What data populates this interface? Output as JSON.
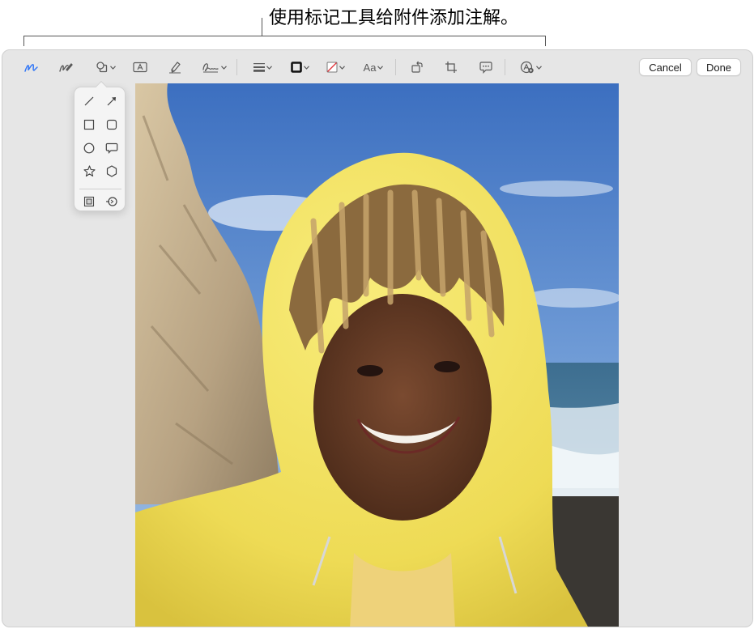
{
  "caption": {
    "text": "使用标记工具给附件添加注解。"
  },
  "toolbar": {
    "tools": [
      {
        "name": "sketch-tool",
        "icon": "sketch-pen-icon",
        "active": true
      },
      {
        "name": "draw-tool",
        "icon": "draw-pen-icon"
      },
      {
        "name": "shapes-tool",
        "icon": "shapes-icon",
        "has_menu": true
      },
      {
        "name": "text-tool",
        "icon": "text-box-icon"
      },
      {
        "name": "highlight-tool",
        "icon": "highlighter-icon"
      },
      {
        "name": "sign-tool",
        "icon": "signature-icon",
        "has_menu": true
      },
      {
        "name": "shape-style-tool",
        "icon": "line-weight-icon",
        "has_menu": true
      },
      {
        "name": "border-color-tool",
        "icon": "border-color-icon",
        "has_menu": true
      },
      {
        "name": "fill-color-tool",
        "icon": "fill-color-icon",
        "has_menu": true
      },
      {
        "name": "text-style-tool",
        "icon": "text-style-icon",
        "has_menu": true
      },
      {
        "name": "rotate-tool",
        "icon": "rotate-icon"
      },
      {
        "name": "crop-tool",
        "icon": "crop-icon"
      },
      {
        "name": "description-tool",
        "icon": "speech-bubble-icon"
      },
      {
        "name": "more-tools",
        "icon": "more-tools-icon",
        "has_menu": true
      }
    ],
    "text_style_label": "Aa",
    "cancel_label": "Cancel",
    "done_label": "Done",
    "accent_color": "#3478f6"
  },
  "shapes_popover": {
    "items": [
      "line-icon",
      "arrow-icon",
      "square-icon",
      "rounded-square-icon",
      "circle-icon",
      "speech-bubble-shape-icon",
      "star-icon",
      "hexagon-icon",
      "mask-icon",
      "loupe-icon"
    ]
  },
  "photo": {
    "subject": "smiling person in yellow hooded raincoat at the beach"
  }
}
